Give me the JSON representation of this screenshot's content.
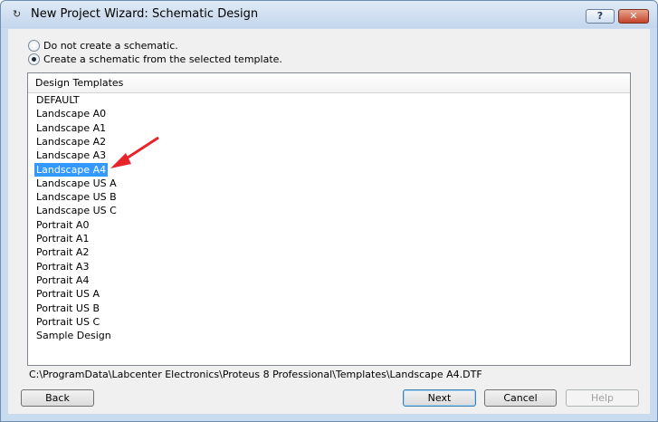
{
  "window": {
    "title": "New Project Wizard: Schematic Design",
    "icon": "wizard-icon",
    "help_glyph": "?",
    "close_glyph": "✕"
  },
  "options": [
    {
      "label": "Do not create a schematic.",
      "checked": false
    },
    {
      "label": "Create a schematic from the selected template.",
      "checked": true
    }
  ],
  "templates": {
    "header": "Design Templates",
    "selected_index": 5,
    "items": [
      "DEFAULT",
      "Landscape A0",
      "Landscape A1",
      "Landscape A2",
      "Landscape A3",
      "Landscape A4",
      "Landscape US A",
      "Landscape US B",
      "Landscape US C",
      "Portrait A0",
      "Portrait A1",
      "Portrait A2",
      "Portrait A3",
      "Portrait A4",
      "Portrait US A",
      "Portrait US B",
      "Portrait US C",
      "Sample Design"
    ]
  },
  "template_path": "C:\\ProgramData\\Labcenter Electronics\\Proteus 8 Professional\\Templates\\Landscape A4.DTF",
  "buttons": {
    "back": "Back",
    "next": "Next",
    "cancel": "Cancel",
    "help": "Help"
  },
  "colors": {
    "selection": "#3399ff",
    "annotation_arrow": "#e8242b"
  }
}
